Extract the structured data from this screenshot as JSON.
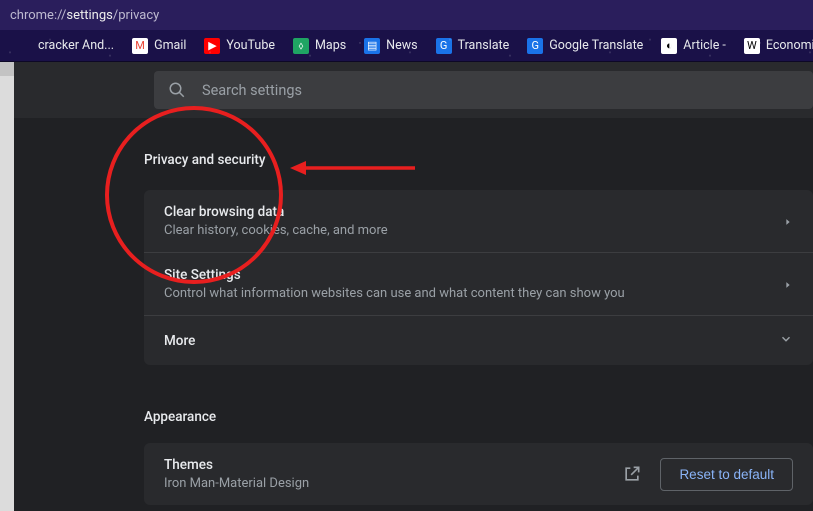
{
  "address_bar": {
    "prefix": "chrome://",
    "bold": "settings",
    "suffix": "/privacy"
  },
  "bookmarks": [
    {
      "label": "cracker And...",
      "icon_bg": "transparent",
      "icon_txt": ""
    },
    {
      "label": "Gmail",
      "icon_bg": "#ffffff",
      "icon_txt": "M",
      "icon_color": "#ea4335"
    },
    {
      "label": "YouTube",
      "icon_bg": "#ff0000",
      "icon_txt": "▶",
      "icon_color": "#ffffff"
    },
    {
      "label": "Maps",
      "icon_bg": "#1fa463",
      "icon_txt": "⬨",
      "icon_color": "#ffffff"
    },
    {
      "label": "News",
      "icon_bg": "#1a73e8",
      "icon_txt": "▤",
      "icon_color": "#ffffff"
    },
    {
      "label": "Translate",
      "icon_bg": "#1a73e8",
      "icon_txt": "G",
      "icon_color": "#ffffff"
    },
    {
      "label": "Google Translate",
      "icon_bg": "#1a73e8",
      "icon_txt": "G",
      "icon_color": "#ffffff"
    },
    {
      "label": "Article -",
      "icon_bg": "#ffffff",
      "icon_txt": "◐",
      "icon_color": "#000000"
    },
    {
      "label": "Economic impact of.",
      "icon_bg": "#ffffff",
      "icon_txt": "W",
      "icon_color": "#000000"
    }
  ],
  "search": {
    "placeholder": "Search settings"
  },
  "privacy": {
    "heading": "Privacy and security",
    "items": [
      {
        "title": "Clear browsing data",
        "sub": "Clear history, cookies, cache, and more",
        "chev": "right"
      },
      {
        "title": "Site Settings",
        "sub": "Control what information websites can use and what content they can show you",
        "chev": "right"
      },
      {
        "title": "More",
        "sub": "",
        "chev": "down"
      }
    ]
  },
  "appearance": {
    "heading": "Appearance",
    "themes_title": "Themes",
    "themes_sub": "Iron Man-Material Design",
    "reset_label": "Reset to default"
  },
  "annotation": {
    "color": "#e81f1f"
  }
}
